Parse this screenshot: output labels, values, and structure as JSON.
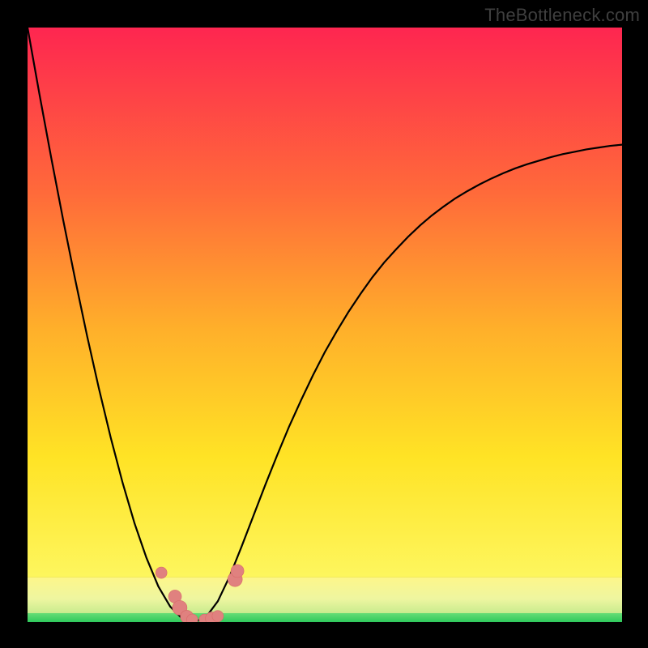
{
  "watermark": {
    "text": "TheBottleneck.com"
  },
  "colors": {
    "bg_black": "#000000",
    "watermark_gray": "#3f3f3f",
    "curve_stroke": "#000000",
    "marker_fill": "#e0817f",
    "marker_stroke": "#d86a69",
    "green_band": "#3fd264",
    "pale_band": "#f3f8a2",
    "grad_top": "#fe2650",
    "grad_mid1": "#ff6a3a",
    "grad_mid2": "#ffb02a",
    "grad_mid3": "#ffe325",
    "grad_bottom": "#fdf65e"
  },
  "chart_data": {
    "type": "line",
    "title": "",
    "xlabel": "",
    "ylabel": "",
    "x": [
      0.0,
      0.02,
      0.04,
      0.06,
      0.08,
      0.1,
      0.12,
      0.14,
      0.16,
      0.18,
      0.2,
      0.22,
      0.24,
      0.26,
      0.28,
      0.3,
      0.32,
      0.34,
      0.36,
      0.38,
      0.4,
      0.42,
      0.44,
      0.46,
      0.48,
      0.5,
      0.52,
      0.54,
      0.56,
      0.58,
      0.6,
      0.62,
      0.64,
      0.66,
      0.68,
      0.7,
      0.72,
      0.74,
      0.76,
      0.78,
      0.8,
      0.82,
      0.84,
      0.86,
      0.88,
      0.9,
      0.92,
      0.94,
      0.96,
      0.98,
      1.0
    ],
    "series": [
      {
        "name": "curve",
        "values": [
          1.0,
          0.888,
          0.78,
          0.676,
          0.577,
          0.482,
          0.393,
          0.31,
          0.234,
          0.166,
          0.108,
          0.06,
          0.026,
          0.006,
          0.0,
          0.008,
          0.035,
          0.077,
          0.127,
          0.179,
          0.231,
          0.281,
          0.329,
          0.373,
          0.415,
          0.454,
          0.489,
          0.522,
          0.552,
          0.58,
          0.605,
          0.627,
          0.648,
          0.667,
          0.684,
          0.699,
          0.713,
          0.725,
          0.736,
          0.746,
          0.755,
          0.763,
          0.77,
          0.776,
          0.782,
          0.787,
          0.791,
          0.795,
          0.798,
          0.801,
          0.803
        ]
      }
    ],
    "xlim": [
      0,
      1
    ],
    "ylim": [
      0,
      1
    ],
    "markers": [
      {
        "x": 0.225,
        "y": 0.083,
        "r": 7
      },
      {
        "x": 0.248,
        "y": 0.043,
        "r": 8
      },
      {
        "x": 0.256,
        "y": 0.024,
        "r": 9
      },
      {
        "x": 0.268,
        "y": 0.009,
        "r": 8
      },
      {
        "x": 0.277,
        "y": 0.004,
        "r": 7
      },
      {
        "x": 0.298,
        "y": 0.004,
        "r": 7
      },
      {
        "x": 0.31,
        "y": 0.006,
        "r": 8
      },
      {
        "x": 0.32,
        "y": 0.01,
        "r": 7
      },
      {
        "x": 0.349,
        "y": 0.072,
        "r": 9
      },
      {
        "x": 0.353,
        "y": 0.086,
        "r": 8
      }
    ],
    "gradient_bands": [
      {
        "from": 0.0,
        "to": 0.925,
        "type": "rainbow"
      },
      {
        "from": 0.925,
        "to": 0.985,
        "type": "pale"
      },
      {
        "from": 0.985,
        "to": 1.0,
        "type": "green"
      }
    ]
  }
}
